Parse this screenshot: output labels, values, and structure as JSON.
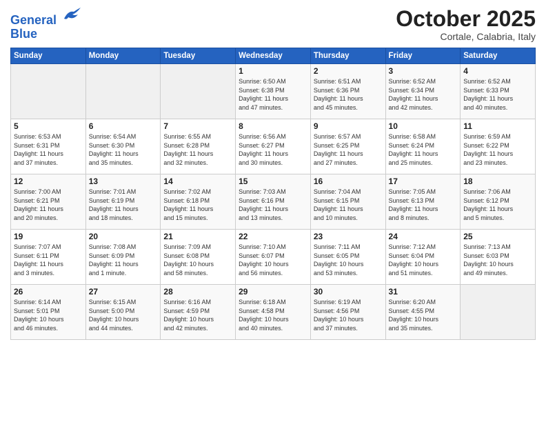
{
  "header": {
    "logo_line1": "General",
    "logo_line2": "Blue",
    "month": "October 2025",
    "location": "Cortale, Calabria, Italy"
  },
  "weekdays": [
    "Sunday",
    "Monday",
    "Tuesday",
    "Wednesday",
    "Thursday",
    "Friday",
    "Saturday"
  ],
  "weeks": [
    [
      {
        "day": "",
        "info": ""
      },
      {
        "day": "",
        "info": ""
      },
      {
        "day": "",
        "info": ""
      },
      {
        "day": "1",
        "info": "Sunrise: 6:50 AM\nSunset: 6:38 PM\nDaylight: 11 hours\nand 47 minutes."
      },
      {
        "day": "2",
        "info": "Sunrise: 6:51 AM\nSunset: 6:36 PM\nDaylight: 11 hours\nand 45 minutes."
      },
      {
        "day": "3",
        "info": "Sunrise: 6:52 AM\nSunset: 6:34 PM\nDaylight: 11 hours\nand 42 minutes."
      },
      {
        "day": "4",
        "info": "Sunrise: 6:52 AM\nSunset: 6:33 PM\nDaylight: 11 hours\nand 40 minutes."
      }
    ],
    [
      {
        "day": "5",
        "info": "Sunrise: 6:53 AM\nSunset: 6:31 PM\nDaylight: 11 hours\nand 37 minutes."
      },
      {
        "day": "6",
        "info": "Sunrise: 6:54 AM\nSunset: 6:30 PM\nDaylight: 11 hours\nand 35 minutes."
      },
      {
        "day": "7",
        "info": "Sunrise: 6:55 AM\nSunset: 6:28 PM\nDaylight: 11 hours\nand 32 minutes."
      },
      {
        "day": "8",
        "info": "Sunrise: 6:56 AM\nSunset: 6:27 PM\nDaylight: 11 hours\nand 30 minutes."
      },
      {
        "day": "9",
        "info": "Sunrise: 6:57 AM\nSunset: 6:25 PM\nDaylight: 11 hours\nand 27 minutes."
      },
      {
        "day": "10",
        "info": "Sunrise: 6:58 AM\nSunset: 6:24 PM\nDaylight: 11 hours\nand 25 minutes."
      },
      {
        "day": "11",
        "info": "Sunrise: 6:59 AM\nSunset: 6:22 PM\nDaylight: 11 hours\nand 23 minutes."
      }
    ],
    [
      {
        "day": "12",
        "info": "Sunrise: 7:00 AM\nSunset: 6:21 PM\nDaylight: 11 hours\nand 20 minutes."
      },
      {
        "day": "13",
        "info": "Sunrise: 7:01 AM\nSunset: 6:19 PM\nDaylight: 11 hours\nand 18 minutes."
      },
      {
        "day": "14",
        "info": "Sunrise: 7:02 AM\nSunset: 6:18 PM\nDaylight: 11 hours\nand 15 minutes."
      },
      {
        "day": "15",
        "info": "Sunrise: 7:03 AM\nSunset: 6:16 PM\nDaylight: 11 hours\nand 13 minutes."
      },
      {
        "day": "16",
        "info": "Sunrise: 7:04 AM\nSunset: 6:15 PM\nDaylight: 11 hours\nand 10 minutes."
      },
      {
        "day": "17",
        "info": "Sunrise: 7:05 AM\nSunset: 6:13 PM\nDaylight: 11 hours\nand 8 minutes."
      },
      {
        "day": "18",
        "info": "Sunrise: 7:06 AM\nSunset: 6:12 PM\nDaylight: 11 hours\nand 5 minutes."
      }
    ],
    [
      {
        "day": "19",
        "info": "Sunrise: 7:07 AM\nSunset: 6:11 PM\nDaylight: 11 hours\nand 3 minutes."
      },
      {
        "day": "20",
        "info": "Sunrise: 7:08 AM\nSunset: 6:09 PM\nDaylight: 11 hours\nand 1 minute."
      },
      {
        "day": "21",
        "info": "Sunrise: 7:09 AM\nSunset: 6:08 PM\nDaylight: 10 hours\nand 58 minutes."
      },
      {
        "day": "22",
        "info": "Sunrise: 7:10 AM\nSunset: 6:07 PM\nDaylight: 10 hours\nand 56 minutes."
      },
      {
        "day": "23",
        "info": "Sunrise: 7:11 AM\nSunset: 6:05 PM\nDaylight: 10 hours\nand 53 minutes."
      },
      {
        "day": "24",
        "info": "Sunrise: 7:12 AM\nSunset: 6:04 PM\nDaylight: 10 hours\nand 51 minutes."
      },
      {
        "day": "25",
        "info": "Sunrise: 7:13 AM\nSunset: 6:03 PM\nDaylight: 10 hours\nand 49 minutes."
      }
    ],
    [
      {
        "day": "26",
        "info": "Sunrise: 6:14 AM\nSunset: 5:01 PM\nDaylight: 10 hours\nand 46 minutes."
      },
      {
        "day": "27",
        "info": "Sunrise: 6:15 AM\nSunset: 5:00 PM\nDaylight: 10 hours\nand 44 minutes."
      },
      {
        "day": "28",
        "info": "Sunrise: 6:16 AM\nSunset: 4:59 PM\nDaylight: 10 hours\nand 42 minutes."
      },
      {
        "day": "29",
        "info": "Sunrise: 6:18 AM\nSunset: 4:58 PM\nDaylight: 10 hours\nand 40 minutes."
      },
      {
        "day": "30",
        "info": "Sunrise: 6:19 AM\nSunset: 4:56 PM\nDaylight: 10 hours\nand 37 minutes."
      },
      {
        "day": "31",
        "info": "Sunrise: 6:20 AM\nSunset: 4:55 PM\nDaylight: 10 hours\nand 35 minutes."
      },
      {
        "day": "",
        "info": ""
      }
    ]
  ]
}
